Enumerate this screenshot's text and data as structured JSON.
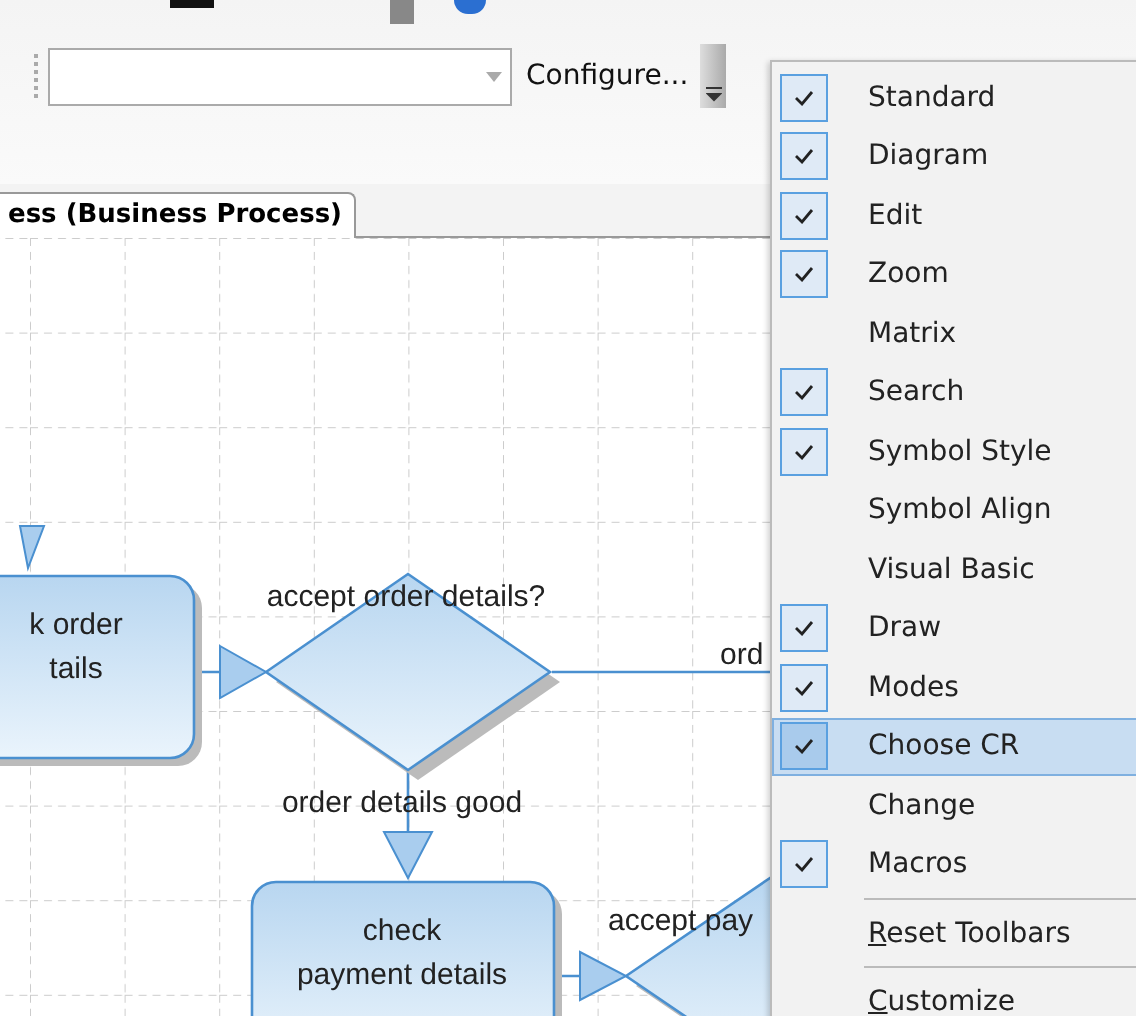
{
  "toolbar": {
    "action_label": "Configure..."
  },
  "tab": {
    "label": "ess (Business Process)"
  },
  "diagram": {
    "nodes": [
      {
        "kind": "box",
        "lines": [
          "k order",
          "tails"
        ]
      },
      {
        "kind": "diamond",
        "label": "accept order details?"
      },
      {
        "kind": "box",
        "lines": [
          "check",
          "payment details"
        ]
      },
      {
        "kind": "diamond",
        "label": "accept pay"
      }
    ],
    "edge_labels": [
      "ord",
      "order details good"
    ]
  },
  "menu": {
    "items": [
      {
        "label": "Standard",
        "checked": true,
        "selected": false
      },
      {
        "label": "Diagram",
        "checked": true,
        "selected": false
      },
      {
        "label": "Edit",
        "checked": true,
        "selected": false
      },
      {
        "label": "Zoom",
        "checked": true,
        "selected": false
      },
      {
        "label": "Matrix",
        "checked": false,
        "selected": false
      },
      {
        "label": "Search",
        "checked": true,
        "selected": false
      },
      {
        "label": "Symbol Style",
        "checked": true,
        "selected": false
      },
      {
        "label": "Symbol Align",
        "checked": false,
        "selected": false
      },
      {
        "label": "Visual Basic",
        "checked": false,
        "selected": false
      },
      {
        "label": "Draw",
        "checked": true,
        "selected": false
      },
      {
        "label": "Modes",
        "checked": true,
        "selected": false
      },
      {
        "label": "Choose CR",
        "checked": true,
        "selected": true
      },
      {
        "label": "Change",
        "checked": false,
        "selected": false
      },
      {
        "label": "Macros",
        "checked": true,
        "selected": false
      }
    ],
    "commands": [
      {
        "label": "Reset Toolbars",
        "underlined_first_letter": true
      },
      {
        "label": "Customize",
        "underlined_first_letter": true
      }
    ]
  }
}
